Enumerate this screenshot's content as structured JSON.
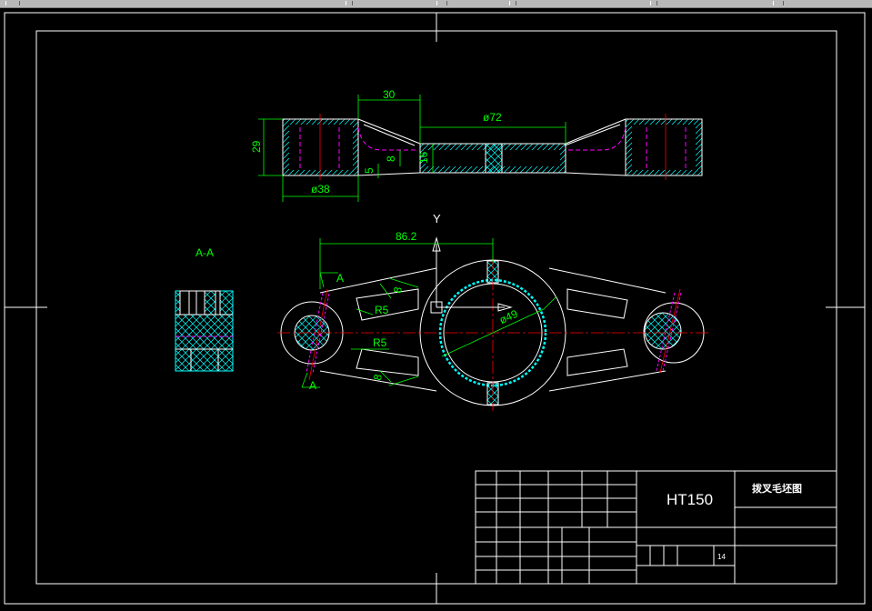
{
  "window": {
    "toolbar_strip": "menu/toolbar strip (cropped)"
  },
  "drawing": {
    "section_label": "A-A",
    "y_axis_label": "Y",
    "section_marker_top": "A",
    "section_marker_bottom": "A",
    "dims": {
      "top_width": "30",
      "top_dia": "ø72",
      "height_left": "29",
      "dim_16": "16",
      "dim_8": "8",
      "dim_5": "5",
      "bottom_dia": "ø38",
      "span": "86.2",
      "bore_dia": "ø49",
      "r_upper": "R5",
      "r_lower": "R5",
      "rib_top": "8",
      "rib_bottom": "8"
    }
  },
  "title_block": {
    "material": "HT150",
    "drawing_name": "拨叉毛坯图",
    "sheet_no": "14"
  },
  "colors": {
    "background": "#000000",
    "outline": "#ffffff",
    "dimension": "#00ff00",
    "hatch": "#00ffff",
    "hidden": "#ff00ff",
    "center": "#ff0000"
  }
}
